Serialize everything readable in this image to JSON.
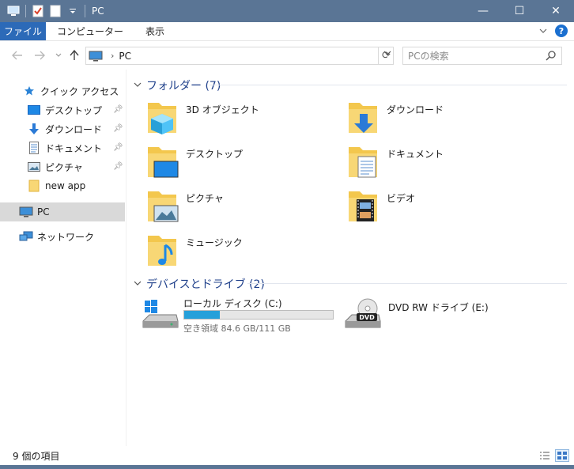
{
  "window": {
    "title": "PC",
    "minimize": "—",
    "maximize": "☐",
    "close": "✕"
  },
  "ribbon": {
    "tabs": [
      "ファイル",
      "コンピューター",
      "表示"
    ]
  },
  "address": {
    "path": "PC",
    "search_placeholder": "PCの検索"
  },
  "nav": {
    "quick_access": "クイック アクセス",
    "items": [
      {
        "label": "デスクトップ",
        "icon": "desktop-icon",
        "pinned": true
      },
      {
        "label": "ダウンロード",
        "icon": "download-icon",
        "pinned": true
      },
      {
        "label": "ドキュメント",
        "icon": "document-icon",
        "pinned": true
      },
      {
        "label": "ピクチャ",
        "icon": "picture-icon",
        "pinned": true
      },
      {
        "label": "new app",
        "icon": "folder-icon",
        "pinned": false
      }
    ],
    "pc": "PC",
    "network": "ネットワーク"
  },
  "folders": {
    "header": "フォルダー (7)",
    "items": [
      {
        "label": "3D オブジェクト",
        "icon": "3d-objects-folder-icon"
      },
      {
        "label": "ダウンロード",
        "icon": "downloads-folder-icon"
      },
      {
        "label": "デスクトップ",
        "icon": "desktop-folder-icon"
      },
      {
        "label": "ドキュメント",
        "icon": "documents-folder-icon"
      },
      {
        "label": "ピクチャ",
        "icon": "pictures-folder-icon"
      },
      {
        "label": "ビデオ",
        "icon": "videos-folder-icon"
      },
      {
        "label": "ミュージック",
        "icon": "music-folder-icon"
      }
    ]
  },
  "drives": {
    "header": "デバイスとドライブ (2)",
    "local": {
      "label": "ローカル ディスク (C:)",
      "free_text": "空き領域 84.6 GB/111 GB",
      "used_fraction": 0.24,
      "bar_color": "#26a0da"
    },
    "dvd": {
      "label": "DVD RW ドライブ (E:)"
    }
  },
  "status": {
    "count": "9 個の項目"
  },
  "colors": {
    "titlebar": "#5a7595",
    "file_tab": "#2c6ab8",
    "group_header": "#1e3f8a",
    "selection": "#d9d9d9"
  }
}
